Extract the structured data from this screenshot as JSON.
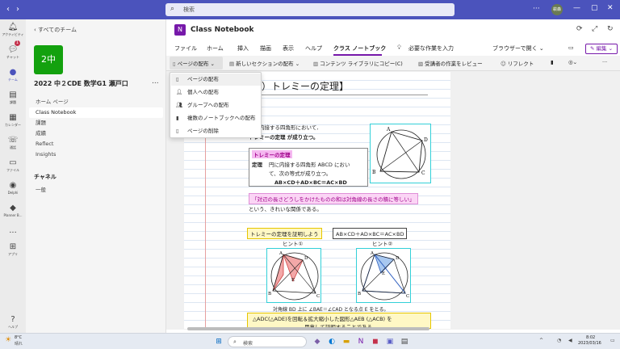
{
  "titlebar": {
    "search_placeholder": "検索",
    "user_initials": "萩森",
    "window_controls": [
      "minimize",
      "maximize",
      "close"
    ]
  },
  "rail": {
    "badge": "1",
    "items": [
      {
        "label": "アクティビティ",
        "icon": "bell-icon"
      },
      {
        "label": "チャット",
        "icon": "chat-icon"
      },
      {
        "label": "チーム",
        "icon": "teams-icon",
        "active": true
      },
      {
        "label": "課題",
        "icon": "assignments-icon"
      },
      {
        "label": "カレンダー",
        "icon": "calendar-icon"
      },
      {
        "label": "通話",
        "icon": "phone-icon"
      },
      {
        "label": "ファイル",
        "icon": "files-icon"
      },
      {
        "label": "Delphi",
        "icon": "delphi-icon"
      },
      {
        "label": "Planner B...",
        "icon": "planner-icon"
      }
    ],
    "more_label": "...",
    "apps_label": "アプリ",
    "help_label": "ヘルプ"
  },
  "panel": {
    "back_label": "すべてのチーム",
    "team_tile": "2中",
    "team_name": "2022 中２CDE 数学G1 瀬戸口",
    "team_more": "...",
    "channels_menu": [
      "ホーム ページ",
      "Class Notebook",
      "課題",
      "成績",
      "Reflect",
      "Insights"
    ],
    "channels_heading": "チャネル",
    "channels": [
      "一般"
    ]
  },
  "app": {
    "title": "Class Notebook",
    "menus": [
      "ファイル",
      "ホーム",
      "挿入",
      "描画",
      "表示",
      "ヘルプ",
      "クラス ノートブック"
    ],
    "tell_me": "必要な作業を入力",
    "open_in_browser": "ブラウザーで開く",
    "edit_label": "編集"
  },
  "ribbon": {
    "page_distribute": "ページの配布",
    "new_section_distribute": "新しいセクションの配布",
    "copy_to_library": "コンテンツ ライブラリにコピー(C)",
    "review_student_work": "受講者の作業をレビュー",
    "reflect": "リフレクト"
  },
  "dropdown": {
    "items": [
      {
        "label": "ページの配布",
        "icon": "page-icon"
      },
      {
        "label": "個人への配布",
        "icon": "person-icon"
      },
      {
        "label": "グループへの配布",
        "icon": "group-icon"
      },
      {
        "label": "複数のノートブックへの配布",
        "icon": "notebooks-icon"
      },
      {
        "label": "ページの削除",
        "icon": "delete-page-icon"
      }
    ]
  },
  "page": {
    "title": "発展）トレミーの定理】",
    "line1": "円に内接する四角形において,",
    "line2": "トレミーの定理 が成り立つ。",
    "theorem_head": "トレミーの定理",
    "theorem_label": "定理",
    "theorem_text1": "円に内接する四角形 ABCD におい",
    "theorem_text2": "て、次の等式が成り立つ。",
    "theorem_eq": "AB×CD＋AD×BC＝AC×BD",
    "quote": "「対辺の長さどうしをかけたものの和は対角線の長さの積に等しい」",
    "quote_after": "という、きれいな関係である。",
    "proof_head": "トレミーの定理を証明しよう",
    "proof_eq": "AB×CD＋AD×BC＝AC×BD",
    "hint1": "ヒント①",
    "hint2": "ヒント②",
    "hint_caption": "対角線 BD 上に ∠BAE＝∠CAD となる点 E をとる。",
    "hint_box1": "△ADC(△ADE)を回転＆拡大縮小した図形△AEB (△ACB) を",
    "hint_box2": "用意して証明することである",
    "labels": {
      "A": "A",
      "B": "B",
      "C": "C",
      "D": "D",
      "E": "E"
    }
  },
  "taskbar": {
    "weather_temp": "8°C",
    "weather_text": "晴れ",
    "search_placeholder": "検索",
    "time": "8:02",
    "date": "2023/03/16"
  }
}
